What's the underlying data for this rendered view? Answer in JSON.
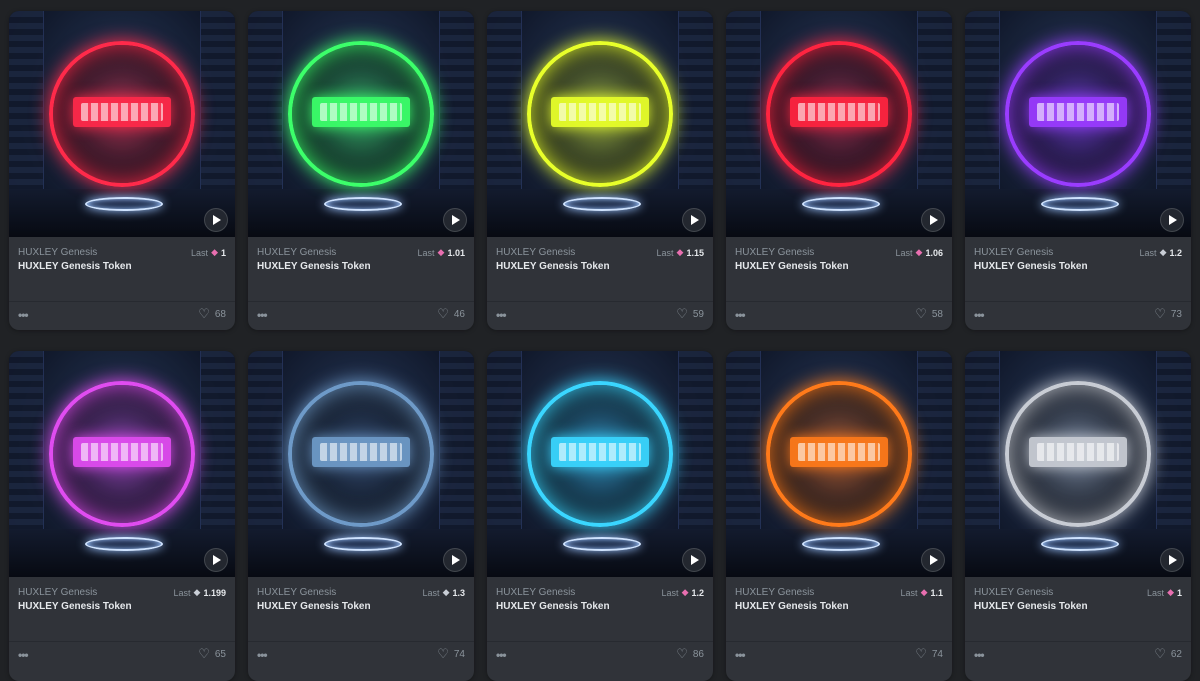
{
  "cards": [
    {
      "collection": "HUXLEY Genesis",
      "name": "HUXLEY Genesis Token",
      "last_label": "Last",
      "currency": "pink-eth-icon",
      "price": "1",
      "likes": "68",
      "color": "#ff2a4a",
      "glow": "rgba(255,40,70,0.55)"
    },
    {
      "collection": "HUXLEY Genesis",
      "name": "HUXLEY Genesis Token",
      "last_label": "Last",
      "currency": "pink-eth-icon",
      "price": "1.01",
      "likes": "46",
      "color": "#3cff6a",
      "glow": "rgba(60,255,110,0.55)"
    },
    {
      "collection": "HUXLEY Genesis",
      "name": "HUXLEY Genesis Token",
      "last_label": "Last",
      "currency": "pink-eth-icon",
      "price": "1.15",
      "likes": "59",
      "color": "#e8ff2a",
      "glow": "rgba(230,255,40,0.55)"
    },
    {
      "collection": "HUXLEY Genesis",
      "name": "HUXLEY Genesis Token",
      "last_label": "Last",
      "currency": "pink-eth-icon",
      "price": "1.06",
      "likes": "58",
      "color": "#ff2440",
      "glow": "rgba(220,30,60,0.55)"
    },
    {
      "collection": "HUXLEY Genesis",
      "name": "HUXLEY Genesis Token",
      "last_label": "Last",
      "currency": "dark-eth-icon",
      "price": "1.2",
      "likes": "73",
      "color": "#9a3cff",
      "glow": "rgba(140,50,255,0.55)"
    },
    {
      "collection": "HUXLEY Genesis",
      "name": "HUXLEY Genesis Token",
      "last_label": "Last",
      "currency": "dark-eth-icon",
      "price": "1.199",
      "likes": "65",
      "color": "#e04cf0",
      "glow": "rgba(220,70,240,0.5)"
    },
    {
      "collection": "HUXLEY Genesis",
      "name": "HUXLEY Genesis Token",
      "last_label": "Last",
      "currency": "dark-eth-icon",
      "price": "1.3",
      "likes": "74",
      "color": "#6e9ac8",
      "glow": "rgba(60,90,130,0.45)"
    },
    {
      "collection": "HUXLEY Genesis",
      "name": "HUXLEY Genesis Token",
      "last_label": "Last",
      "currency": "pink-eth-icon",
      "price": "1.2",
      "likes": "86",
      "color": "#3ad6ff",
      "glow": "rgba(50,200,255,0.55)"
    },
    {
      "collection": "HUXLEY Genesis",
      "name": "HUXLEY Genesis Token",
      "last_label": "Last",
      "currency": "pink-eth-icon",
      "price": "1.1",
      "likes": "74",
      "color": "#ff7a1a",
      "glow": "rgba(255,110,20,0.55)"
    },
    {
      "collection": "HUXLEY Genesis",
      "name": "HUXLEY Genesis Token",
      "last_label": "Last",
      "currency": "pink-eth-icon",
      "price": "1",
      "likes": "62",
      "color": "#c8ccd4",
      "glow": "rgba(200,210,220,0.45)"
    }
  ]
}
